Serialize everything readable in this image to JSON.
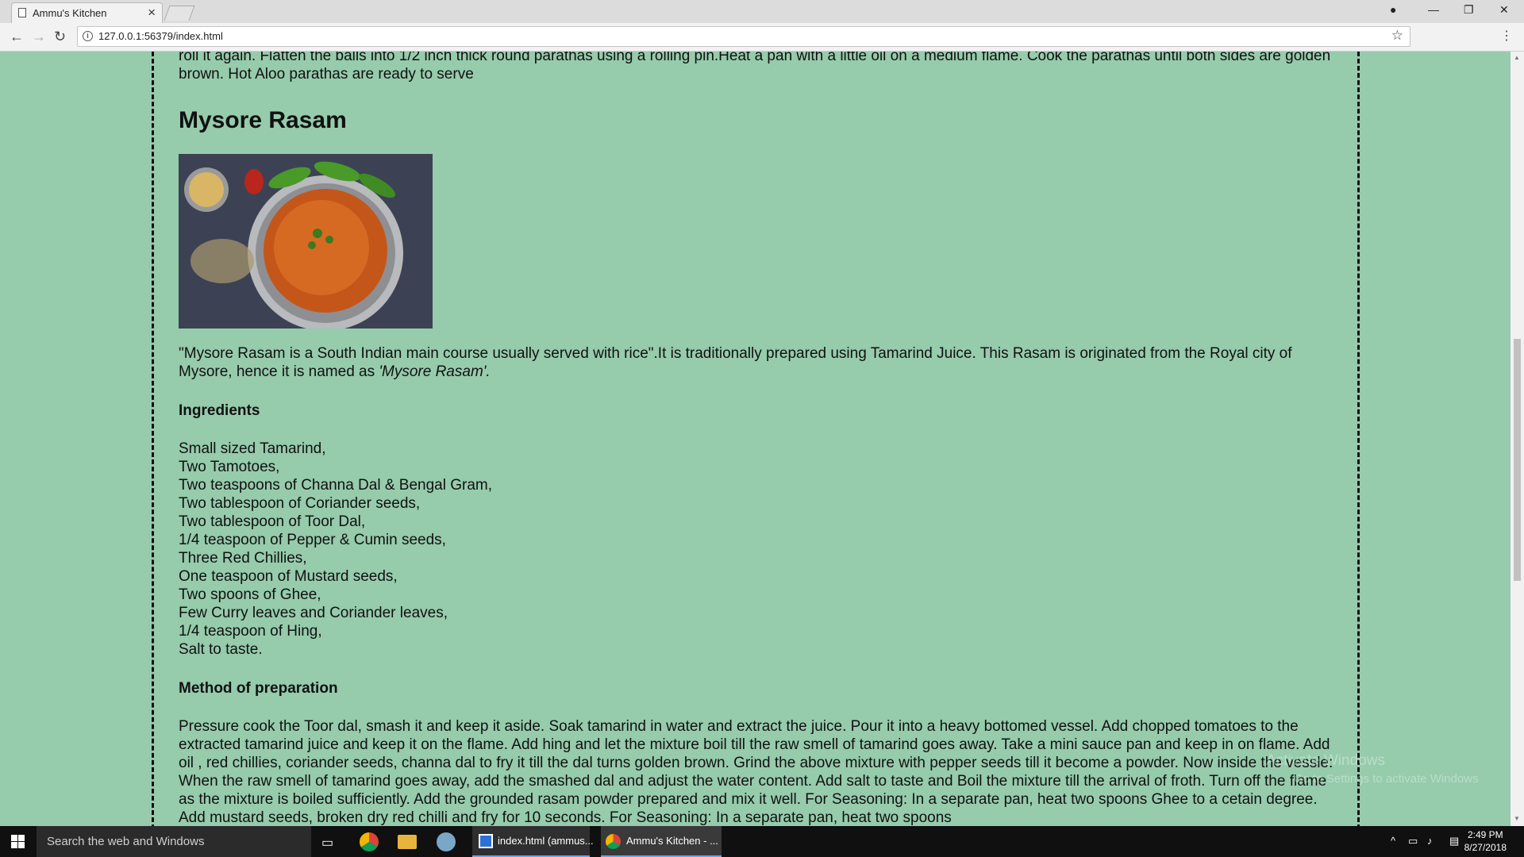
{
  "browser": {
    "tab_title": "Ammu's Kitchen",
    "url": "127.0.0.1:56379/index.html"
  },
  "page": {
    "top_text": "roll it again. Flatten the balls into 1/2 inch thick round parathas using a rolling pin.Heat a pan with a little oil on a medium flame. Cook the parathas until both sides are golden brown. Hot Aloo parathas are ready to serve",
    "recipe_title": "Mysore Rasam",
    "description_plain": "\"Mysore Rasam is a South Indian main course usually served with rice\".It is traditionally prepared using Tamarind Juice. This Rasam is originated from the Royal city of Mysore, hence it is named as ",
    "description_italic": "'Mysore Rasam'.",
    "ingredients_heading": "Ingredients",
    "ingredients": [
      "Small sized Tamarind,",
      "Two Tamotoes,",
      "Two teaspoons of Channa Dal & Bengal Gram,",
      "Two tablespoon of Coriander seeds,",
      "Two tablespoon of Toor Dal,",
      "1/4 teaspoon of Pepper & Cumin seeds,",
      "Three Red Chillies,",
      "One teaspoon of Mustard seeds,",
      "Two spoons of Ghee,",
      "Few Curry leaves and Coriander leaves,",
      "1/4 teaspoon of Hing,",
      "Salt to taste."
    ],
    "method_heading": "Method of preparation",
    "method_text": "Pressure cook the Toor dal, smash it and keep it aside. Soak tamarind in water and extract the juice. Pour it into a heavy bottomed vessel. Add chopped tomatoes to the extracted tamarind juice and keep it on the flame. Add hing and let the mixture boil till the raw smell of tamarind goes away. Take a mini sauce pan and keep in on flame. Add oil , red chillies, coriander seeds, channa dal to fry it till the dal turns golden brown. Grind the above mixture with pepper seeds till it become a powder. Now inside the vessle: When the raw smell of tamarind goes away, add the smashed dal and adjust the water content. Add salt to taste and Boil the mixture till the arrival of froth. Turn off the flame as the mixture is boiled sufficiently. Add the grounded rasam powder prepared and mix it well. For Seasoning: In a separate pan, heat two spoons Ghee to a cetain degree. Add mustard seeds, broken dry red chilli and fry for 10 seconds. For Seasoning: In a separate pan, heat two spoons",
    "watermark_line1": "Activate Windows",
    "watermark_line2": "Go to Settings to activate Windows"
  },
  "taskbar": {
    "search_placeholder": "Search the web and Windows",
    "app1": "index.html (ammus...",
    "app2": "Ammu's Kitchen - ...",
    "time": "2:49 PM",
    "date": "8/27/2018"
  }
}
